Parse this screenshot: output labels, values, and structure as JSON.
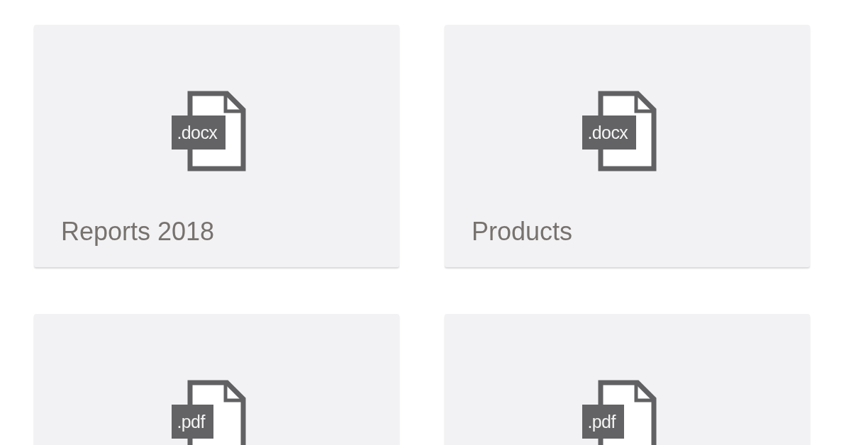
{
  "files": [
    {
      "extension": ".docx",
      "name": "Reports 2018"
    },
    {
      "extension": ".docx",
      "name": "Products"
    },
    {
      "extension": ".pdf"
    },
    {
      "extension": ".pdf"
    }
  ]
}
